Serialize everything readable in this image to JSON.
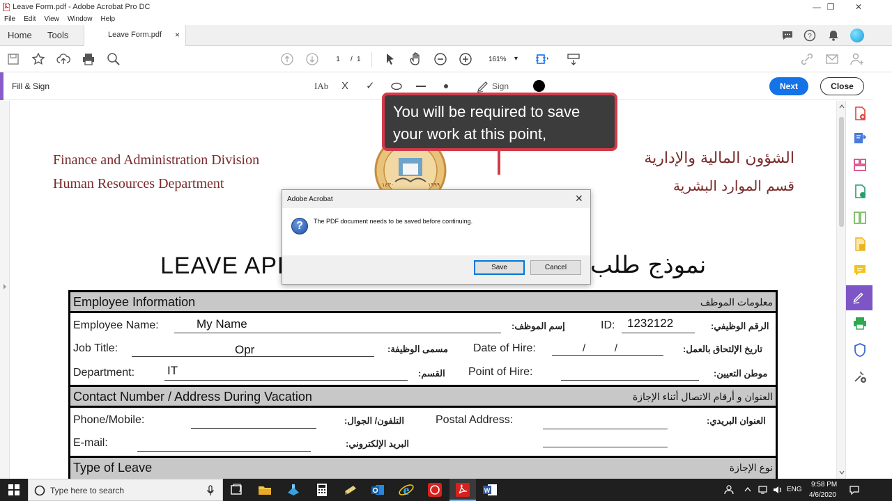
{
  "window": {
    "title": "Leave Form.pdf - Adobe Acrobat Pro DC",
    "controls": {
      "minimize": "—",
      "maximize": "❐",
      "close": "✕"
    }
  },
  "menu": [
    "File",
    "Edit",
    "View",
    "Window",
    "Help"
  ],
  "tabs": {
    "home": "Home",
    "tools": "Tools",
    "document": "Leave Form.pdf",
    "close_symbol": "×"
  },
  "toolbar": {
    "page_current": "1",
    "page_sep": "/",
    "page_total": "1",
    "zoom": "161%",
    "zoom_arrow": "▾"
  },
  "fill_sign": {
    "title": "Fill & Sign",
    "text_tool": "IAb",
    "cross": "X",
    "check": "✓",
    "sign_label": "Sign",
    "next_button": "Next",
    "close_button": "Close"
  },
  "document": {
    "header_en_line1": "Finance and Administration Division",
    "header_en_line2": "Human Resources Department",
    "header_ar_line1": "الشؤون المالية والإدارية",
    "header_ar_line2": "قسم الموارد البشرية",
    "form_title_en": "LEAVE APP",
    "form_title_ar": "نموذج طلب",
    "sections": {
      "employee_info": {
        "en": "Employee Information",
        "ar": "معلومات الموظف"
      },
      "contact": {
        "en": "Contact Number / Address During Vacation",
        "ar": "العنوان و أرقام الاتصال أثناء الإجازة"
      },
      "leave_type": {
        "en": "Type of Leave",
        "ar": "نوع الإجازة"
      }
    },
    "fields": {
      "employee_name_label": "Employee Name:",
      "employee_name_value": "My Name",
      "employee_name_ar": "إسم الموظف:",
      "id_label": "ID:",
      "id_value": "1232122",
      "id_ar": "الرقم الوظيفي:",
      "job_title_label": "Job Title:",
      "job_title_value": "Opr",
      "job_title_ar": "مسمى الوظيفة:",
      "date_of_hire_label": "Date of Hire:",
      "date_of_hire_value": "/          /",
      "date_of_hire_ar": "تاريخ الإلتحاق بالعمل:",
      "department_label": "Department:",
      "department_value": "IT",
      "department_ar": "القسم:",
      "point_of_hire_label": "Point of Hire:",
      "point_of_hire_ar": "موطن التعيين:",
      "phone_label": "Phone/Mobile:",
      "phone_ar": "التلفون/ الجوال:",
      "postal_label": "Postal Address:",
      "postal_ar": "العنوان البريدي:",
      "email_label": "E-mail:",
      "email_ar": "البريد الإلكتروني:"
    },
    "seal_text_left": "١٤٣٠",
    "seal_text_right": "١٩٩٩"
  },
  "tooltip": {
    "text": "You will be required to save your work at this point,"
  },
  "dialog": {
    "title": "Adobe Acrobat",
    "close": "✕",
    "icon": "?",
    "message": "The PDF document needs to be saved before continuing.",
    "save": "Save",
    "cancel": "Cancel"
  },
  "taskbar": {
    "search_placeholder": "Type here to search",
    "lang": "ENG",
    "time": "9:58 PM",
    "date": "4/6/2020"
  },
  "colors": {
    "accent_blue": "#1473e6",
    "fill_sign_purple": "#8a5cc9",
    "tooltip_border": "#d33a4a",
    "header_maroon": "#7a2a2a"
  }
}
